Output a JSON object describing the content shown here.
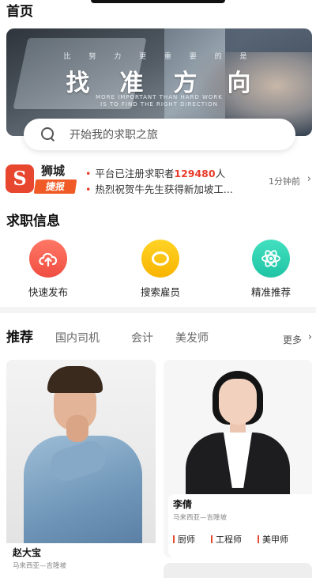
{
  "header": {
    "title": "首页"
  },
  "banner": {
    "small_text": "比 努 力 更 重 要 的 是",
    "headline": "找准方向",
    "english_line1": "MORE IMPORTANT THAN HARD WORK",
    "english_line2": "IS TO FIND THE RIGHT DIRECTION"
  },
  "search": {
    "placeholder": "开始我的求职之旅"
  },
  "news": {
    "logo_char": "S",
    "brand": "狮城",
    "tag": "捷报",
    "line1_prefix": "平台已注册求职者",
    "line1_count": "129480",
    "line1_suffix": "人",
    "line2": "热烈祝贺牛先生获得新加坡工...",
    "time": "1分钟前"
  },
  "job_section": {
    "title": "求职信息",
    "actions": [
      {
        "label": "快速发布",
        "icon": "cloud-upload-icon",
        "color": "#f05a4a"
      },
      {
        "label": "搜索雇员",
        "icon": "search-employee-icon",
        "color": "#f8c100"
      },
      {
        "label": "精准推荐",
        "icon": "atom-icon",
        "color": "#26c9a8"
      }
    ]
  },
  "recommend": {
    "title": "推荐",
    "tabs": [
      "国内司机",
      "会计",
      "美发师"
    ],
    "more": "更多"
  },
  "cards": [
    {
      "name": "赵大宝",
      "location": "马来西亚—吉隆坡"
    },
    {
      "name": "李倩",
      "location": "马来西亚—吉隆坡",
      "skills": [
        "厨师",
        "工程师",
        "美甲师"
      ]
    }
  ]
}
